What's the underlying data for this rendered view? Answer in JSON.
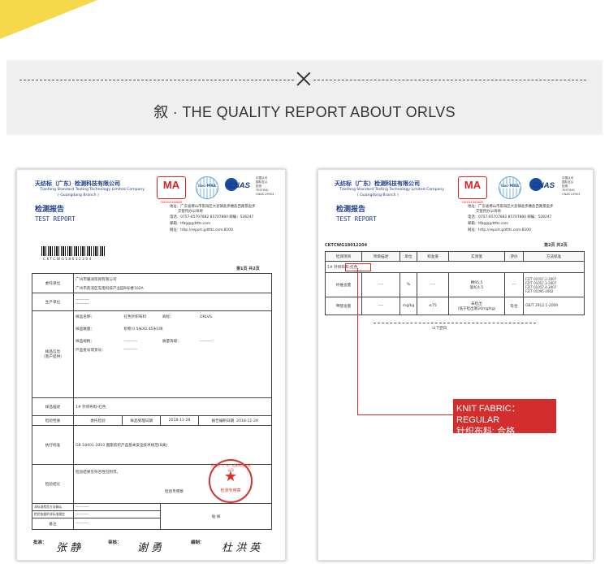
{
  "banner": {
    "title": "叙 · THE QUALITY  REPORT ABOUT ORLVS"
  },
  "lab": {
    "name_cn": "天纺标（广东）检测科技有限公司",
    "name_en": "Tianfang Standard Testing Technology Limited Company",
    "branch_en": "( Guangdong Branch )",
    "report_cn": "检测报告",
    "report_en": "TEST REPORT",
    "ma_mark": "MA",
    "ma_no": "160011343820",
    "ilac_mark": "ilac-MRA",
    "cnas_mark": "CNAS",
    "cnas_lines": [
      "中国认可",
      "国际互认",
      "检测",
      "TESTING",
      "CNAS L9903"
    ],
    "address": "地址：广东省佛山市南海区大沥镇盐步穗盐西路景盈步",
    "address2": "交管所办公场地",
    "phone": "电话：0757-85707882  85707880   邮编：528247",
    "email": "邮箱：tfbg@gdttts.com",
    "web": "网址：http://report.gdttts.com:8100"
  },
  "page1": {
    "report_no": "CKTCWG18012204",
    "page_label": "第1页   共2页",
    "rows": {
      "client_label": "委托单位",
      "client_name": "广州市珊洲贸易有限公司",
      "client_addr": "广州市荔湾区先电科技产业园9号楼102A",
      "maker_label": "生产单位",
      "maker_value": "----------",
      "sample_label": "样品信息\n（客户提供）",
      "sample_name_label": "样品名称：",
      "sample_name": "红色针织布料",
      "brand_label": "商标：",
      "brand": "ORLVS",
      "qty_label": "样品数量：",
      "qty": "织物 0.5米X0.45米1块",
      "spec_label": "样品规格：",
      "spec": "----------",
      "grade_label": "质量等级：",
      "grade": "----------",
      "batch_label": "产品批号或货号：",
      "batch": "----------",
      "desc_label": "样品描述",
      "desc": "1#  针织布料-红色",
      "nature_label": "检验性质",
      "nature": "委托检验",
      "recv_label": "样品受理日期",
      "recv_date": "2018-11-28",
      "done_label": "报告编制日期",
      "done_date": "2018-11-29",
      "std_label": "执行标准",
      "std": "GB 18401-2010  国家纺织产品基本安全技术规范(B类)",
      "concl_label": "检验结论",
      "concl": "检验结果见符合性见附页。",
      "stamp_note": "检验专用章",
      "sign_date_label": "签发日期",
      "agent_label": "非标准检验方法确认",
      "agent_value": "----------",
      "ref_label": "检验依据的非标准规定",
      "ref_value": "----------",
      "other_label": "检验依据的有关规定",
      "other_value": "----------",
      "remark_label": "备注",
      "remark_value": "----------",
      "seal_label": "贴  样"
    },
    "stamp_ring": "天纺标（广东）检测科技有限公司",
    "stamp_label": "检测专用章",
    "approve_label": "批准：",
    "review_label": "审核：",
    "author_label": "编制：",
    "sign1": "张 静",
    "sign2": "谢 勇",
    "sign3": "杜 洪 英"
  },
  "page2": {
    "report_no": "CKTCWG18012204",
    "page_label": "第2页   共2页",
    "headers": [
      "检测项目",
      "项目描述",
      "单位",
      "标准值",
      "实测值",
      "评价",
      "方法标准"
    ],
    "sample_row": "1#  针织布料-红色",
    "rows": [
      {
        "item": "纤维含量",
        "desc": "----",
        "unit": "%",
        "std": "----",
        "measured": "棉95.5\n氨纶4.5",
        "eval": "---",
        "method": "FZ/T 01057.2-2007\nFZ/T 01057.3-2007\nFZ/T 01057.4-2007\nFZ/T 01095-2002"
      },
      {
        "item": "甲醛含量",
        "desc": "----",
        "unit": "mg/kg",
        "std": "≤75",
        "measured": "未检出\n(低于检出限20mg/kg)",
        "eval": "符合",
        "method": "GB/T 2912.1-2009"
      }
    ],
    "blank_note": "以下空白"
  },
  "callout": {
    "line1": "KNIT FABRIC：REGULAR",
    "line2": "针织布料: 合格"
  }
}
